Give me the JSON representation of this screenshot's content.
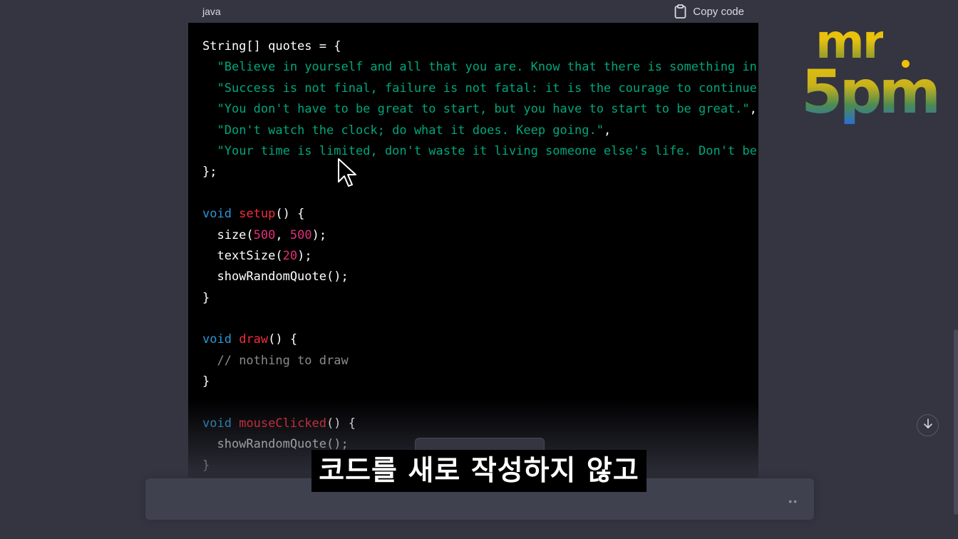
{
  "code_block": {
    "language": "java",
    "copy_label": "Copy code",
    "lines": [
      [
        {
          "t": "String[] quotes = {",
          "c": "plain"
        }
      ],
      [
        {
          "t": "  ",
          "c": "plain"
        },
        {
          "t": "\"Believe in yourself and all that you are. Know that there is something in",
          "c": "str"
        }
      ],
      [
        {
          "t": "  ",
          "c": "plain"
        },
        {
          "t": "\"Success is not final, failure is not fatal: it is the courage to continue",
          "c": "str"
        }
      ],
      [
        {
          "t": "  ",
          "c": "plain"
        },
        {
          "t": "\"You don't have to be great to start, but you have to start to be great.\"",
          "c": "str"
        },
        {
          "t": ",",
          "c": "plain"
        }
      ],
      [
        {
          "t": "  ",
          "c": "plain"
        },
        {
          "t": "\"Don't watch the clock; do what it does. Keep going.\"",
          "c": "str"
        },
        {
          "t": ",",
          "c": "plain"
        }
      ],
      [
        {
          "t": "  ",
          "c": "plain"
        },
        {
          "t": "\"Your time is limited, don't waste it living someone else's life. Don't be",
          "c": "str"
        }
      ],
      [
        {
          "t": "};",
          "c": "plain"
        }
      ],
      [
        {
          "t": "",
          "c": "plain"
        }
      ],
      [
        {
          "t": "void",
          "c": "kw"
        },
        {
          "t": " ",
          "c": "plain"
        },
        {
          "t": "setup",
          "c": "fn"
        },
        {
          "t": "() {",
          "c": "plain"
        }
      ],
      [
        {
          "t": "  size(",
          "c": "plain"
        },
        {
          "t": "500",
          "c": "num"
        },
        {
          "t": ", ",
          "c": "plain"
        },
        {
          "t": "500",
          "c": "num"
        },
        {
          "t": ");",
          "c": "plain"
        }
      ],
      [
        {
          "t": "  textSize(",
          "c": "plain"
        },
        {
          "t": "20",
          "c": "num"
        },
        {
          "t": ");",
          "c": "plain"
        }
      ],
      [
        {
          "t": "  showRandomQuote();",
          "c": "plain"
        }
      ],
      [
        {
          "t": "}",
          "c": "plain"
        }
      ],
      [
        {
          "t": "",
          "c": "plain"
        }
      ],
      [
        {
          "t": "void",
          "c": "kw"
        },
        {
          "t": " ",
          "c": "plain"
        },
        {
          "t": "draw",
          "c": "fn"
        },
        {
          "t": "() {",
          "c": "plain"
        }
      ],
      [
        {
          "t": "  ",
          "c": "plain"
        },
        {
          "t": "// nothing to draw",
          "c": "cmt"
        }
      ],
      [
        {
          "t": "}",
          "c": "plain"
        }
      ],
      [
        {
          "t": "",
          "c": "plain"
        }
      ],
      [
        {
          "t": "void",
          "c": "kw"
        },
        {
          "t": " ",
          "c": "plain"
        },
        {
          "t": "mouseClicked",
          "c": "fn"
        },
        {
          "t": "() {",
          "c": "plain"
        }
      ],
      [
        {
          "t": "  showRandomQuote();",
          "c": "plain"
        }
      ],
      [
        {
          "t": "}",
          "c": "plain"
        }
      ]
    ]
  },
  "logo": {
    "line1": "mr",
    "line2": "5pm"
  },
  "subtitle": "코드를 새로 작성하지 않고",
  "input": {
    "send_glyph": "••"
  },
  "icons": {
    "copy": "clipboard-icon",
    "scroll_down": "arrow-down-icon",
    "cursor": "mouse-pointer-icon"
  },
  "colors": {
    "page_bg": "#343541",
    "code_bg": "#000000",
    "string": "#00a67d",
    "keyword": "#2e95d3",
    "function": "#f22c3d",
    "number": "#df3079",
    "comment": "#8a8a8a"
  }
}
